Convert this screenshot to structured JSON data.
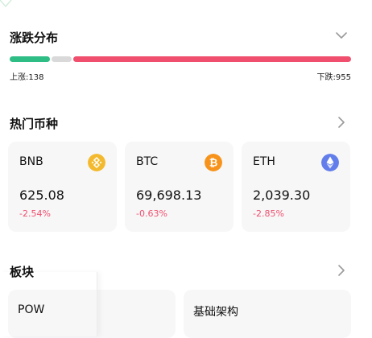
{
  "distribution": {
    "title": "涨跌分布",
    "rise_label": "上涨:138",
    "fall_label": "下跌:955",
    "rise_count": 138,
    "flat_share": 0.06,
    "fall_count": 955,
    "colors": {
      "rise": "#2ebd85",
      "flat": "#d9d9d9",
      "fall": "#f0506e"
    }
  },
  "hot": {
    "title": "热门币种",
    "coins": [
      {
        "symbol": "BNB",
        "price": "625.08",
        "change": "-2.54%",
        "icon": "bnb-icon",
        "color": "#f3ba2f"
      },
      {
        "symbol": "BTC",
        "price": "69,698.13",
        "change": "-0.63%",
        "icon": "btc-icon",
        "color": "#f7931a"
      },
      {
        "symbol": "ETH",
        "price": "2,039.30",
        "change": "-2.85%",
        "icon": "eth-icon",
        "color": "#627eea"
      }
    ]
  },
  "sectors": {
    "title": "板块",
    "items": [
      {
        "label": "POW"
      },
      {
        "label": "基础架构"
      }
    ]
  },
  "colors": {
    "negative": "#f0506e",
    "chevron": "#9a9a9a"
  }
}
